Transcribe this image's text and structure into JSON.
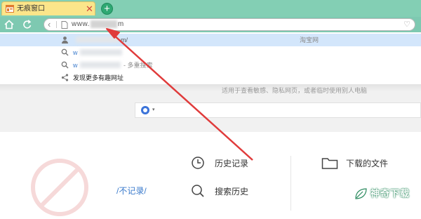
{
  "tab": {
    "title": "无痕窗口",
    "close_glyph": "✕",
    "new_tab_glyph": "+"
  },
  "address": {
    "prefix": "www.",
    "suffix": "m",
    "favorite_glyph": "♡",
    "back_glyph": "‹"
  },
  "suggestions": [
    {
      "text": "m/",
      "right_text": "淘宝网",
      "icon": "person-icon"
    },
    {
      "text": "w",
      "icon": "search-icon"
    },
    {
      "text": "w",
      "tail": "- 多重搜索",
      "icon": "search-icon"
    },
    {
      "text": "发现更多有趣网址",
      "icon": "share-icon"
    }
  ],
  "notice_text": "适用于查看敏感、隐私网页，或者临时使用别人电脑",
  "engine": {
    "caret": "▾",
    "accent": "#3b73d9"
  },
  "no_record_text": "/不记录/",
  "links": {
    "history": "历史记录",
    "search_history": "搜索历史",
    "downloads": "下载的文件"
  },
  "watermark": "神奇下载",
  "colors": {
    "titlebar": "#83cfb4",
    "toolbar": "#7ec9b1",
    "tab": "#fbe58a",
    "highlight": "#d3e6fb",
    "arrow": "#e03b3b"
  }
}
